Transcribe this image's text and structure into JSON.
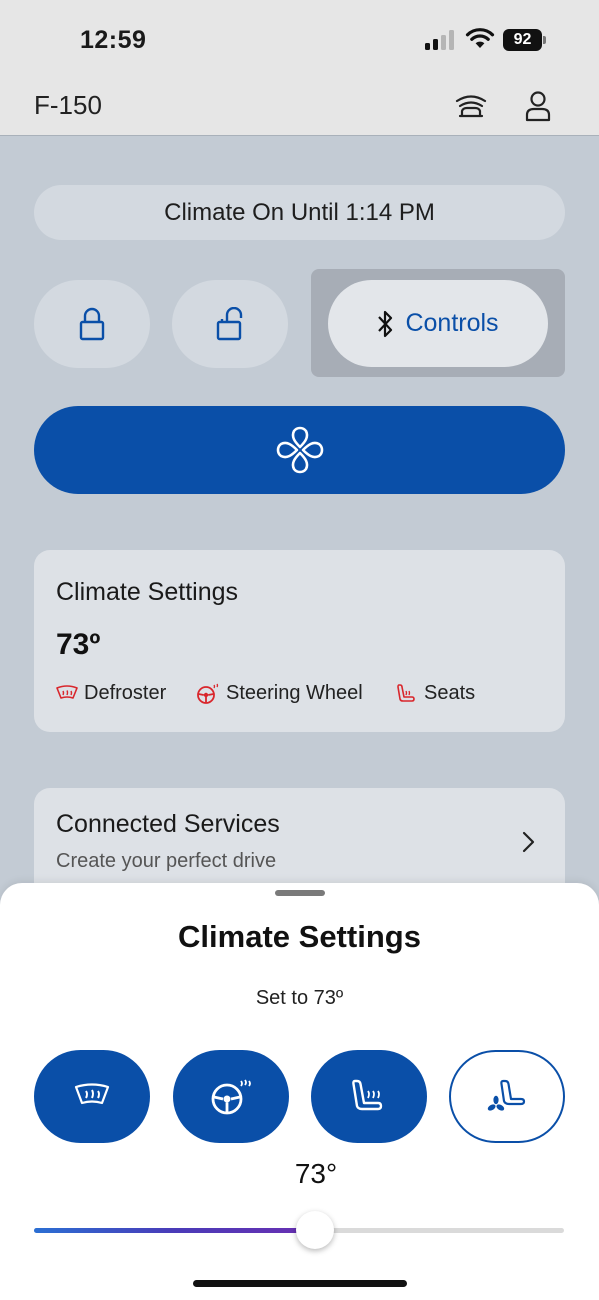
{
  "status_bar": {
    "time": "12:59",
    "battery": "92"
  },
  "header": {
    "vehicle_name": "F-150"
  },
  "climate_status": "Climate On Until 1:14 PM",
  "quick_actions": {
    "lock_icon": "lock-icon",
    "unlock_icon": "unlock-icon",
    "controls_label": "Controls",
    "fan_icon": "fan-icon"
  },
  "climate_card": {
    "title": "Climate Settings",
    "temperature": "73º",
    "features": [
      {
        "label": "Defroster",
        "icon": "defroster-icon"
      },
      {
        "label": "Steering Wheel",
        "icon": "heated-steering-wheel-icon"
      },
      {
        "label": "Seats",
        "icon": "heated-seat-icon"
      }
    ]
  },
  "services_card": {
    "title": "Connected Services",
    "subtitle": "Create your perfect drive"
  },
  "sheet": {
    "title": "Climate Settings",
    "subtitle": "Set to 73º",
    "options": [
      {
        "name": "defroster",
        "active": true
      },
      {
        "name": "heated-steering-wheel",
        "active": true
      },
      {
        "name": "heated-seat",
        "active": true
      },
      {
        "name": "ventilated-seat",
        "active": false
      }
    ],
    "slider": {
      "value_label": "73°",
      "fill_fraction": 0.53
    }
  },
  "colors": {
    "accent": "#0a4fa8",
    "alert": "#d9262c",
    "background": "#c3cbd4"
  }
}
